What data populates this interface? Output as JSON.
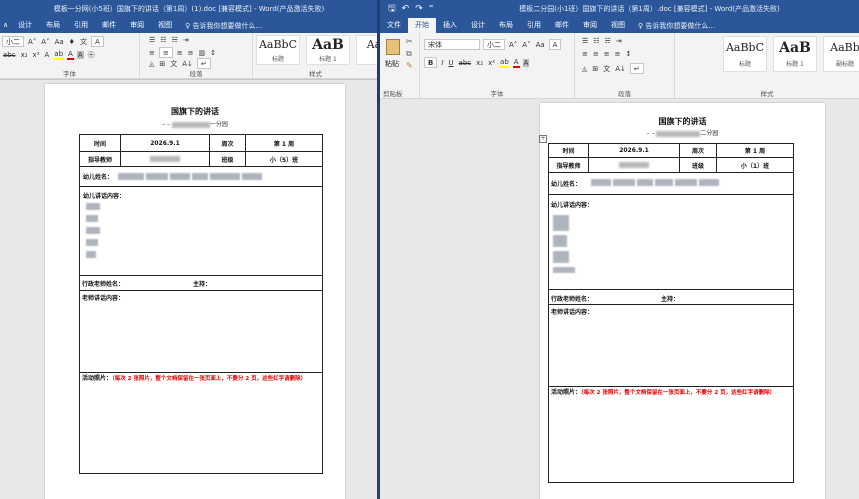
{
  "left_window": {
    "title": "模板一分网(小5班）国旗下的讲话（第1周）(1).doc [兼容模式] - Word(产品激活失败)",
    "tabs": [
      "文件",
      "设计",
      "布局",
      "引用",
      "邮件",
      "审阅",
      "视图"
    ],
    "visible_tabs": [
      "设计",
      "布局",
      "引用",
      "邮件",
      "审阅",
      "视图"
    ],
    "tell_me": "告诉我你想要做什么...",
    "font_size": "小二",
    "styles": [
      {
        "sample": "AaBbC",
        "name": "标题"
      },
      {
        "sample": "AaB",
        "name": "标题 1"
      },
      {
        "sample": "AaE",
        "name": ""
      }
    ],
    "group_labels": {
      "font": "字体",
      "paragraph": "段落",
      "styles": "样式"
    },
    "doc": {
      "title": "国旗下的讲话",
      "subtitle_suffix": "一分园",
      "labels": {
        "time": "时间",
        "date": "2026.9.1",
        "week_label": "周次",
        "week": "第 1 周",
        "teacher": "指导教师",
        "class_label": "班级",
        "class": "小（5）班",
        "child_name": "幼儿姓名：",
        "child_speech": "幼儿讲话内容：",
        "admin_teacher": "行政老师姓名：",
        "host": "主持：",
        "teacher_speech": "老师讲话内容：",
        "activity_label": "活动照片：",
        "activity_note": "（每次 2 张照片，整个文档保留在一张页面上，不要分 2 页，这些红字请删除）"
      }
    }
  },
  "right_window": {
    "title": "模板二分园(小1班）国旗下的讲话（第1周）.doc [兼容模式] - Word(产品激活失败)",
    "qat": {
      "save": "保存",
      "undo": "撤销",
      "redo": "重做"
    },
    "tabs": [
      "文件",
      "开始",
      "插入",
      "设计",
      "布局",
      "引用",
      "邮件",
      "审阅",
      "视图"
    ],
    "active_tab": "开始",
    "tell_me": "告诉我你想要做什么...",
    "font_name": "宋体",
    "font_size": "小二",
    "paste_label": "粘贴",
    "styles": [
      {
        "sample": "AaBbC",
        "name": "标题"
      },
      {
        "sample": "AaB",
        "name": "标题 1"
      },
      {
        "sample": "AaBb",
        "name": "副标题"
      }
    ],
    "group_labels": {
      "clipboard": "剪贴板",
      "font": "字体",
      "paragraph": "段落",
      "styles": "样式"
    },
    "doc": {
      "title": "国旗下的讲话",
      "subtitle_suffix": "二分园",
      "labels": {
        "time": "时间",
        "date": "2026.9.1",
        "week_label": "周次",
        "week": "第 1 周",
        "teacher": "指导教师",
        "class_label": "班级",
        "class": "小（1）班",
        "child_name": "幼儿姓名：",
        "child_speech": "幼儿讲话内容：",
        "admin_teacher": "行政老师姓名：",
        "host": "主持：",
        "teacher_speech": "老师讲话内容：",
        "activity_label": "活动照片：",
        "activity_note": "（每次 2 张照片，整个文档保留在一张页面上，不要分 2 页，这些红字请删除）"
      }
    }
  },
  "colors": {
    "word_blue": "#2b579a",
    "red_note": "#e00000"
  }
}
